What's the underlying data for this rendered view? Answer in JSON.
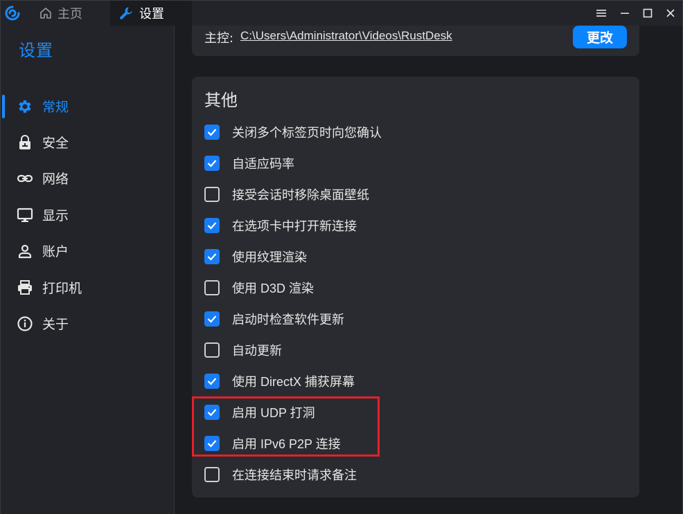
{
  "titlebar": {
    "tabs": [
      {
        "label": "主页",
        "icon": "home-icon"
      },
      {
        "label": "设置",
        "icon": "wrench-icon"
      }
    ]
  },
  "sidebar": {
    "title": "设置",
    "items": [
      {
        "label": "常规",
        "icon": "gear-icon",
        "active": true
      },
      {
        "label": "安全",
        "icon": "lock-icon",
        "active": false
      },
      {
        "label": "网络",
        "icon": "link-icon",
        "active": false
      },
      {
        "label": "显示",
        "icon": "monitor-icon",
        "active": false
      },
      {
        "label": "账户",
        "icon": "person-icon",
        "active": false
      },
      {
        "label": "打印机",
        "icon": "printer-icon",
        "active": false
      },
      {
        "label": "关于",
        "icon": "info-icon",
        "active": false
      }
    ]
  },
  "directory": {
    "label": "主控:",
    "path": "C:\\Users\\Administrator\\Videos\\RustDesk",
    "change_label": "更改"
  },
  "other": {
    "title": "其他",
    "options": [
      {
        "label": "关闭多个标签页时向您确认",
        "checked": true
      },
      {
        "label": "自适应码率",
        "checked": true
      },
      {
        "label": "接受会话时移除桌面壁纸",
        "checked": false
      },
      {
        "label": "在选项卡中打开新连接",
        "checked": true
      },
      {
        "label": "使用纹理渲染",
        "checked": true
      },
      {
        "label": "使用 D3D 渲染",
        "checked": false
      },
      {
        "label": "启动时检查软件更新",
        "checked": true
      },
      {
        "label": "自动更新",
        "checked": false
      },
      {
        "label": "使用 DirectX 捕获屏幕",
        "checked": true
      },
      {
        "label": "启用 UDP 打洞",
        "checked": true
      },
      {
        "label": "启用 IPv6 P2P 连接",
        "checked": true
      },
      {
        "label": "在连接结束时请求备注",
        "checked": false
      }
    ]
  },
  "colors": {
    "accent": "#1a8bff",
    "highlight": "#e5202a"
  }
}
